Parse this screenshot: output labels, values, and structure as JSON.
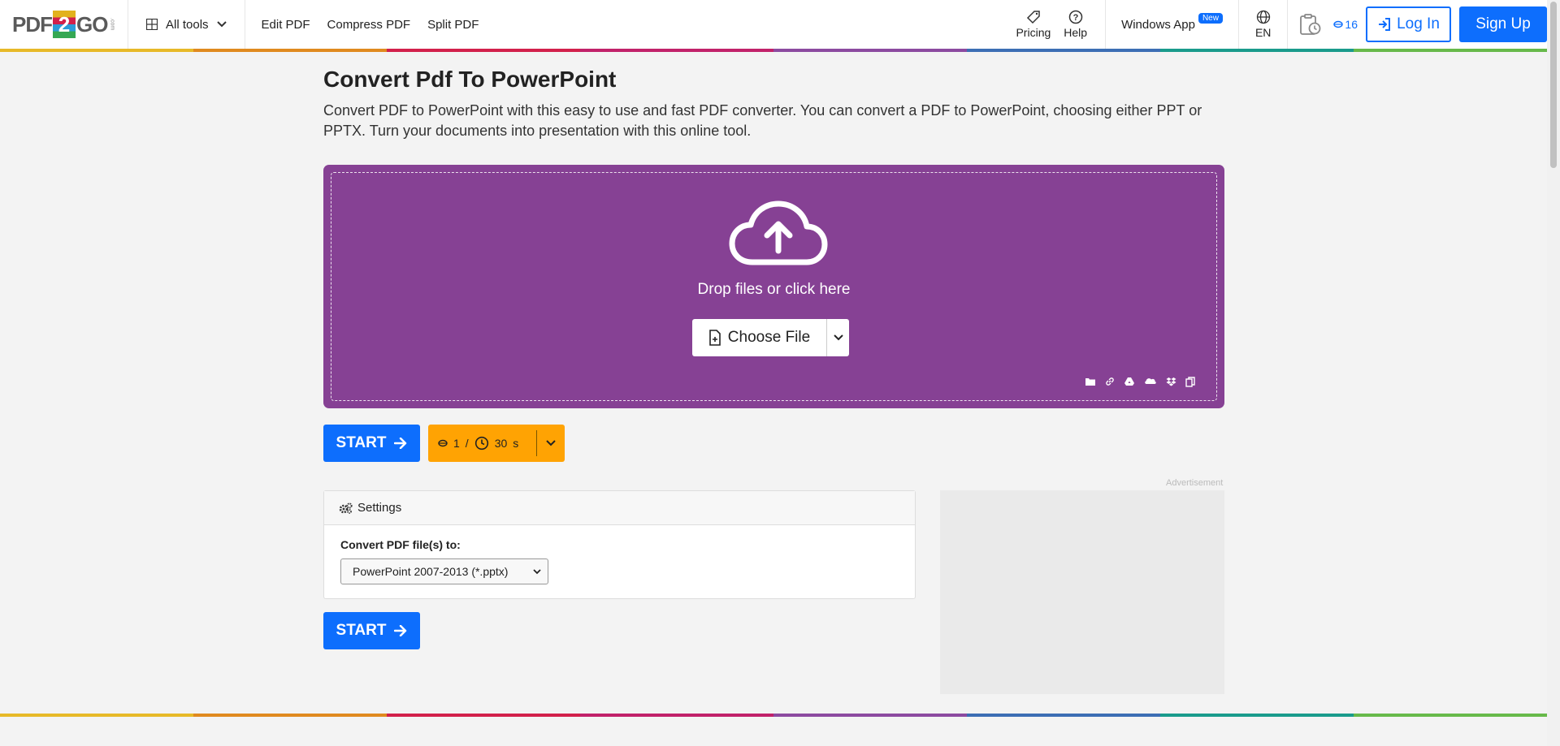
{
  "header": {
    "logo_left": "PDF",
    "logo_two": "2",
    "logo_right": "GO",
    "logo_com": ".com",
    "all_tools": "All tools",
    "nav": [
      "Edit PDF",
      "Compress PDF",
      "Split PDF"
    ],
    "pricing": "Pricing",
    "help": "Help",
    "windows_app": "Windows App",
    "new_badge": "New",
    "lang": "EN",
    "credits": "16",
    "login": "Log In",
    "signup": "Sign Up"
  },
  "colorbar": [
    "#e7b928",
    "#e08a1f",
    "#d2204b",
    "#c1216a",
    "#8c4aa0",
    "#3c6eb4",
    "#1a9b8c",
    "#67b94a"
  ],
  "main": {
    "title": "Convert Pdf To PowerPoint",
    "description": "Convert PDF to PowerPoint with this easy to use and fast PDF converter. You can convert a PDF to PowerPoint, choosing either PPT or PPTX. Turn your documents into presentation with this online tool."
  },
  "dropzone": {
    "color": "#864194",
    "text": "Drop files or click here",
    "choose": "Choose File",
    "sources": [
      "folder-icon",
      "link-icon",
      "google-drive-icon",
      "onedrive-icon",
      "dropbox-icon",
      "clipboard-icon"
    ]
  },
  "start": {
    "label": "START",
    "credit_cost": "1",
    "slash": "/",
    "time": "30",
    "time_unit": "s"
  },
  "settings": {
    "title": "Settings",
    "convert_label": "Convert PDF file(s) to:",
    "selected": "PowerPoint 2007-2013 (*.pptx)"
  },
  "ad": {
    "label": "Advertisement"
  }
}
